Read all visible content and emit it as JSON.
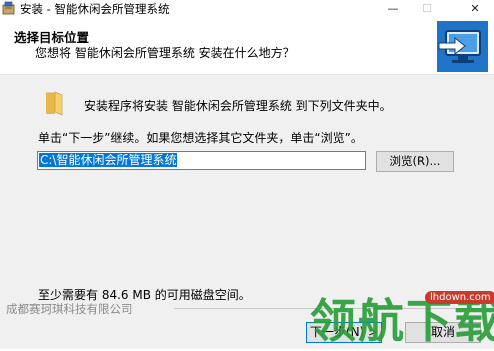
{
  "window": {
    "title": "安装 - 智能休闲会所管理系统",
    "minimize_glyph": "—",
    "maximize_glyph": "☐",
    "close_glyph": "✕"
  },
  "header": {
    "title": "选择目标位置",
    "subtitle": "您想将 智能休闲会所管理系统 安装在什么地方？"
  },
  "content": {
    "intro": "安装程序将安装 智能休闲会所管理系统 到下列文件夹中。",
    "instruction": "单击“下一步”继续。如果您想选择其它文件夹，单击“浏览”。",
    "install_path": "C:\\智能休闲会所管理系统",
    "browse_label": "浏览(R)...",
    "space_required": "至少需要有 84.6 MB 的可用磁盘空间。"
  },
  "footer": {
    "brand": "成都赛珂琪科技有限公司",
    "next_label": "下一步(N) >",
    "cancel_label": "取消"
  },
  "watermark": {
    "text": "领航下载",
    "url": "lhdown.com"
  },
  "icons": {
    "app": "installer-box-icon",
    "folder": "folder-icon",
    "wizard": "monitor-arrow-icon"
  },
  "colors": {
    "selection": "#0078d7",
    "watermark_green": "#2a9f3a"
  }
}
